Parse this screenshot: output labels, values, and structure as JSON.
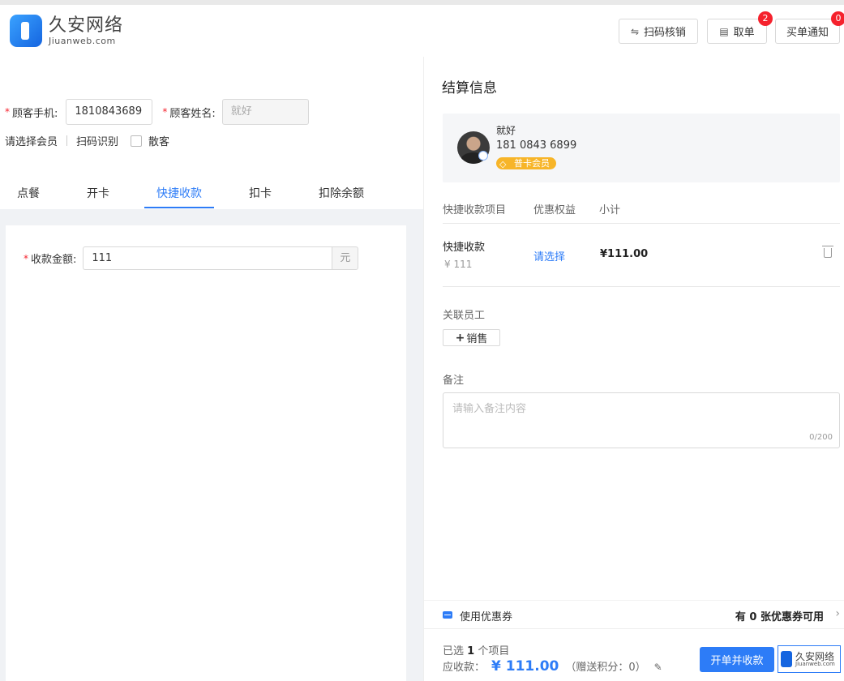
{
  "header": {
    "logo_cn": "久安网络",
    "logo_en": "Jiuanweb.com",
    "scan_verify": "扫码核销",
    "pickup": "取单",
    "pickup_badge": "2",
    "notify": "买单通知",
    "notify_badge": "0"
  },
  "customer": {
    "phone_label": "顾客手机:",
    "phone_value": "1810843689",
    "name_label": "顾客姓名:",
    "name_value": "就好",
    "choose_member": "请选择会员",
    "scan_identify": "扫码识别",
    "walk_in": "散客"
  },
  "tabs": [
    "点餐",
    "开卡",
    "快捷收款",
    "扣卡",
    "扣除余额"
  ],
  "active_tab": "快捷收款",
  "amount": {
    "label": "收款金额:",
    "value": "111",
    "unit": "元"
  },
  "settlement": {
    "title": "结算信息",
    "member_name": "就好",
    "member_phone": "181 0843 6899",
    "member_tag": "普卡会员",
    "col_item": "快捷收款项目",
    "col_discount": "优惠权益",
    "col_subtotal": "小计",
    "item_name": "快捷收款",
    "item_price": "¥ 111",
    "item_choose": "请选择",
    "item_subtotal": "¥111.00",
    "staff_label": "关联员工",
    "staff_button": "销售",
    "note_label": "备注",
    "note_placeholder": "请输入备注内容",
    "note_count": "0/200",
    "coupon_label": "使用优惠券",
    "coupon_available": "有 0 张优惠券可用",
    "selected_prefix": "已选",
    "selected_count": "1",
    "selected_suffix": "个项目",
    "payable_label": "应收款：",
    "payable_amount": "¥ 111.00",
    "gift_points": "（赠送积分：0）",
    "pay_button": "开单并收款"
  },
  "colors": {
    "accent": "#2d7cf7",
    "badge": "#f5222d",
    "member_tag": "#f7b529"
  }
}
